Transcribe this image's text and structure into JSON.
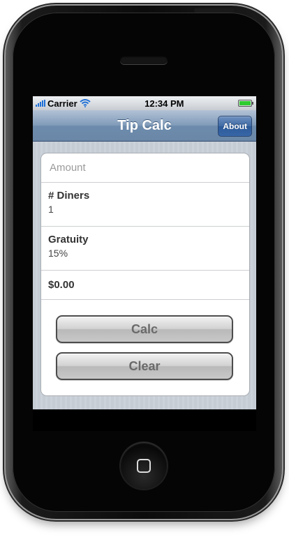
{
  "status": {
    "carrier": "Carrier",
    "time": "12:34 PM",
    "icons": [
      "signal-icon",
      "wifi-icon",
      "battery-icon"
    ]
  },
  "navbar": {
    "title": "Tip Calc",
    "about_label": "About"
  },
  "form": {
    "amount_placeholder": "Amount",
    "amount_value": "",
    "diners_label": "# Diners",
    "diners_value": "1",
    "gratuity_label": "Gratuity",
    "gratuity_value": "15%",
    "total": "$0.00"
  },
  "buttons": {
    "calc_label": "Calc",
    "clear_label": "Clear"
  },
  "colors": {
    "navbar": "#6d8bac",
    "about_button": "#3766a7",
    "background_stripe": "#c5ccd4"
  }
}
